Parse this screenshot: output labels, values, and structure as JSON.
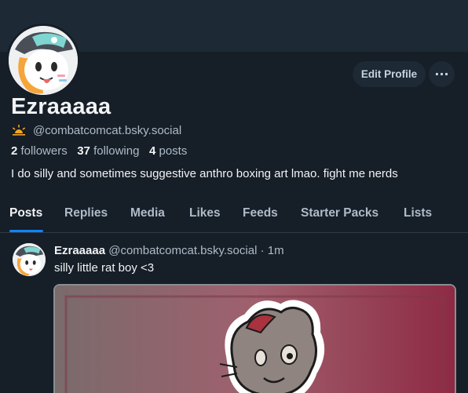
{
  "profile": {
    "display_name": "Ezraaaaa",
    "handle": "@combatcomcat.bsky.social",
    "followers_count": "2",
    "followers_label": "followers",
    "following_count": "37",
    "following_label": "following",
    "posts_count": "4",
    "posts_label": "posts",
    "bio": "I do silly and sometimes suggestive anthro boxing art lmao. fight me nerds"
  },
  "actions": {
    "edit_profile_label": "Edit Profile",
    "more_label": "···"
  },
  "tabs": [
    {
      "label": "Posts",
      "active": true
    },
    {
      "label": "Replies"
    },
    {
      "label": "Media"
    },
    {
      "label": "Likes"
    },
    {
      "label": "Feeds"
    },
    {
      "label": "Starter Packs"
    },
    {
      "label": "Lists"
    }
  ],
  "post": {
    "author_name": "Ezraaaaa",
    "author_handle": "@combatcomcat.bsky.social",
    "separator": "·",
    "time": "1m",
    "text": "silly little rat boy <3"
  },
  "icons": {
    "handle_badge": "sunrise-icon",
    "more": "ellipsis-icon"
  },
  "colors": {
    "background": "#161e27",
    "banner": "#1e2936",
    "accent": "#1083fe",
    "badge": "#f5a623"
  }
}
